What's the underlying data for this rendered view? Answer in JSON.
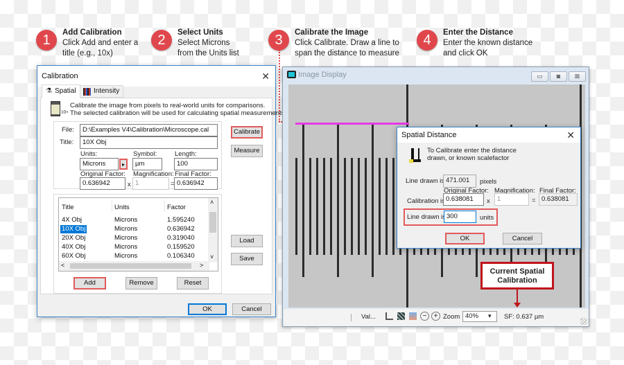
{
  "steps": [
    {
      "num": "1",
      "title": "Add Calibration",
      "text1": "Click Add and enter a",
      "text2": "title (e.g., 10x)"
    },
    {
      "num": "2",
      "title": "Select Units",
      "text1": "Select Microns",
      "text2": "from the Units list"
    },
    {
      "num": "3",
      "title": "Calibrate the Image",
      "text1": "Click Calibrate. Draw a line to",
      "text2": "span the distance to measure"
    },
    {
      "num": "4",
      "title": "Enter the Distance",
      "text1": "Enter the known distance",
      "text2": "and click OK"
    }
  ],
  "calibration_dialog": {
    "title": "Calibration",
    "close_glyph": "✕",
    "tabs": [
      {
        "label": "Spatial",
        "icon": "microscope-icon"
      },
      {
        "label": "Intensity",
        "icon": "intensity-grid-icon"
      }
    ],
    "objective_label": "10×",
    "description_line1": "Calibrate the image from pixels to real-world units for comparisons.",
    "description_line2": "The selected calibration will be used for calculating spatial measurements",
    "file_label": "File:",
    "file_value": "D:\\Examples V4\\Calibration\\Microscope.cal",
    "title_label": "Title:",
    "title_value": "10X Obj",
    "units_label": "Units:",
    "units_value": "Microns",
    "units_dropdown_glyph": "▸",
    "symbol_label": "Symbol:",
    "symbol_value": "µm",
    "length_label": "Length:",
    "length_value": "100",
    "original_factor_label": "Original Factor:",
    "original_factor_value": "0.636942",
    "magnification_label": "Magnification:",
    "magnification_value": "1",
    "final_factor_label": "Final Factor:",
    "final_factor_value": "0.636942",
    "times_glyph": "x",
    "equals_glyph": "=",
    "calibrate_button": "Calibrate",
    "measure_button": "Measure",
    "load_button": "Load",
    "save_button": "Save",
    "list_headers": [
      "Title",
      "Units",
      "Factor"
    ],
    "list_rows": [
      {
        "title": "4X Obj",
        "units": "Microns",
        "factor": "1.595240",
        "selected": false
      },
      {
        "title": "10X Obj",
        "units": "Microns",
        "factor": "0.636942",
        "selected": true
      },
      {
        "title": "20X Obj",
        "units": "Microns",
        "factor": "0.319040",
        "selected": false
      },
      {
        "title": "40X Obj",
        "units": "Microns",
        "factor": "0.159520",
        "selected": false
      },
      {
        "title": "60X Obj",
        "units": "Microns",
        "factor": "0.106340",
        "selected": false
      }
    ],
    "scroll_up": "˄",
    "scroll_down": "˅",
    "scroll_left": "<",
    "scroll_right": ">",
    "add_button": "Add",
    "remove_button": "Remove",
    "reset_button": "Reset",
    "ok_button": "OK",
    "cancel_button": "Cancel"
  },
  "image_display": {
    "title": "Image Display",
    "minimize_glyph": "▭",
    "restore_glyph": "◙",
    "close_glyph": "⊠",
    "status": {
      "values_label": "Val...",
      "zoom_label": "Zoom",
      "zoom_value": "40%",
      "zoom_dropdown_glyph": "▾",
      "scale_factor": "SF: 0.637 µm",
      "zoom_out_glyph": "−",
      "zoom_in_glyph": "+"
    },
    "colors": {
      "calibration_line": "#e838e8"
    }
  },
  "spatial_distance_dialog": {
    "title": "Spatial Distance",
    "close_glyph": "✕",
    "instruction_line1": "To Calibrate enter the distance",
    "instruction_line2": "drawn, or known scalefactor",
    "line_drawn_label": "Line drawn is:",
    "line_drawn_pixels": "471.001",
    "pixels_label": "pixels",
    "calibration_label": "Calibration is:",
    "original_factor_label": "Original Factor:",
    "original_factor_value": "0.638081",
    "magnification_label": "Magnification:",
    "magnification_value": "1",
    "final_factor_label": "Final Factor:",
    "final_factor_value": "0.638081",
    "times_glyph": "x",
    "equals_glyph": "=",
    "line_units_label": "Line drawn is:",
    "line_units_value": "300",
    "units_label": "units",
    "ok_button": "OK",
    "cancel_button": "Cancel"
  },
  "callout": {
    "line1": "Current Spatial",
    "line2": "Calibration"
  },
  "colors": {
    "step_badge": "#e0474c",
    "highlight_border": "#e25a5a",
    "callout_border": "#c0141b"
  }
}
